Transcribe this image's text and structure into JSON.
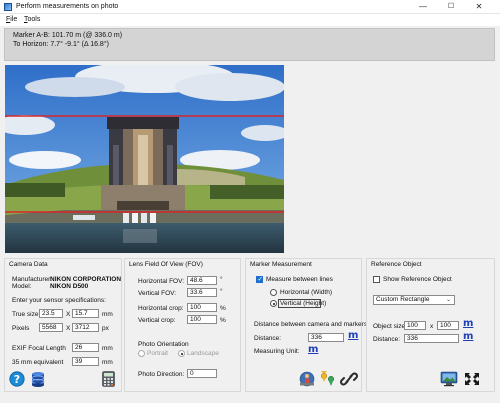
{
  "window": {
    "title": "Perform measurements on photo",
    "minimize": "—",
    "maximize": "☐",
    "close": "✕"
  },
  "menu": {
    "file": "File",
    "tools": "Tools"
  },
  "info": {
    "line1": "Marker A-B: 101.70 m (@ 336.0 m)",
    "line2": "To Horizon: 7.7°  -9.1°  (Δ 16.8°)"
  },
  "camera": {
    "title": "Camera Data",
    "manufacturer_label": "Manufacturer:",
    "model_label": "Model:",
    "manufacturer": "NIKON CORPORATION",
    "model": "NIKON D500",
    "sensor_prompt": "Enter your sensor specifications:",
    "true_size_label": "True size",
    "true_size_w": "23.5",
    "true_size_h": "15.7",
    "size_unit": "mm",
    "pixels_label": "Pixels",
    "pixels_w": "5568",
    "pixels_h": "3712",
    "pixels_unit": "px",
    "x_sep": "X",
    "exif_label": "EXIF Focal Length",
    "exif_value": "26",
    "exif_unit": "mm",
    "equiv_label": "35 mm equivalent",
    "equiv_value": "39",
    "equiv_unit": "mm"
  },
  "fov": {
    "title": "Lens Field Of View (FOV)",
    "h_label": "Horizontal FOV:",
    "h_value": "48.6",
    "v_label": "Vertical FOV:",
    "v_value": "33.6",
    "deg": "°",
    "hcrop_label": "Horizontal crop:",
    "hcrop_value": "100",
    "vcrop_label": "Vertical crop:",
    "vcrop_value": "100",
    "pct": "%",
    "orientation_label": "Photo Orientation",
    "portrait": "Portrait",
    "landscape": "Landscape",
    "direction_label": "Photo Direction:",
    "direction_value": "0"
  },
  "marker": {
    "title": "Marker Measurement",
    "measure_lines_label": "Measure between lines",
    "horizontal_label": "Horizontal (Width)",
    "vertical_label": "Vertical (Height)",
    "distance_heading": "Distance between camera and markers:",
    "distance_label": "Distance:",
    "distance_value": "336",
    "unit_label": "Measuring Unit:",
    "m_symbol": "m"
  },
  "reference": {
    "title": "Reference Object",
    "show_label": "Show Reference Object",
    "shape_value": "Custom Rectangle",
    "size_label": "Object size:",
    "size_w": "100",
    "size_x": "x",
    "size_h": "100",
    "distance_label": "Distance:",
    "distance_value": "336",
    "m_symbol": "m"
  }
}
